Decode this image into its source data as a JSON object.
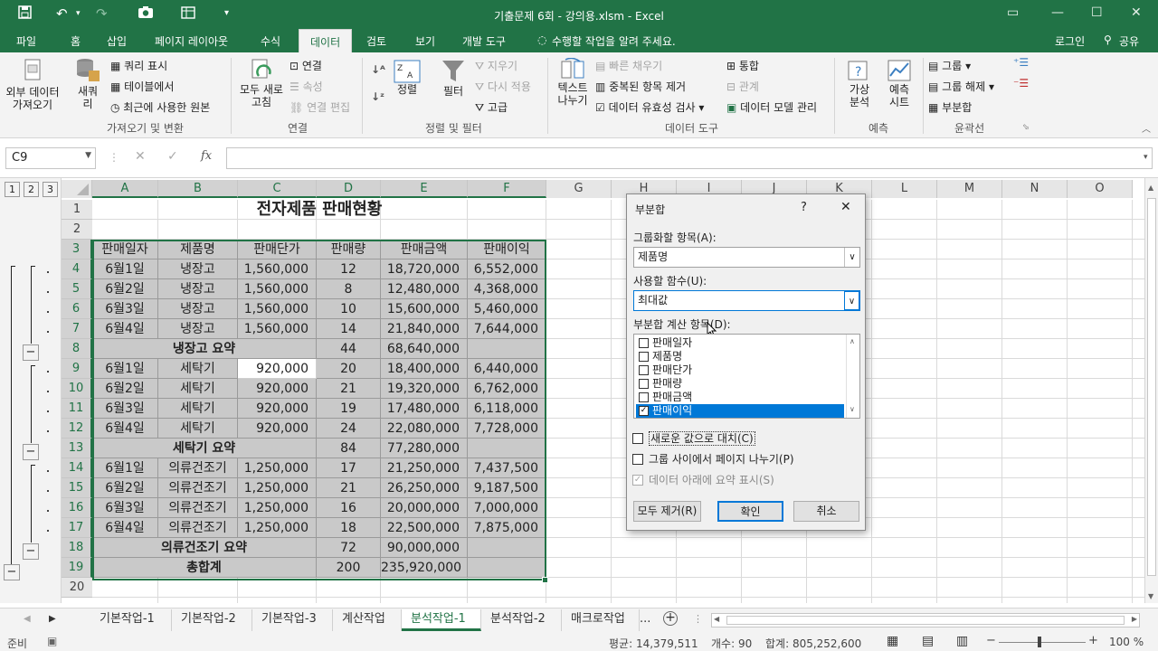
{
  "app": {
    "title": "기출문제 6회 - 강의용.xlsm - Excel",
    "qat_more": "▾"
  },
  "ribbon_tabs": [
    "파일",
    "홈",
    "삽입",
    "페이지 레이아웃",
    "수식",
    "데이터",
    "검토",
    "보기",
    "개발 도구"
  ],
  "tell_me": "수행할 작업을 알려 주세요.",
  "account": {
    "login": "로그인",
    "share": "공유"
  },
  "ribbon": {
    "groups": [
      "가져오기 및 변환",
      "연결",
      "정렬 및 필터",
      "데이터 도구",
      "예측",
      "윤곽선"
    ],
    "get_external": "외부 데이터\n가져오기",
    "new_query": "새쿼\n리",
    "show_query": "쿼리 표시",
    "from_table": "테이블에서",
    "recent_sources": "최근에 사용한 원본",
    "refresh_all": "모두 새로\n고침",
    "connections": "연결",
    "properties": "속성",
    "edit_links": "연결 편집",
    "sort": "정렬",
    "filter": "필터",
    "clear": "지우기",
    "reapply": "다시 적용",
    "advanced": "고급",
    "text_to_columns": "텍스트\n나누기",
    "flash_fill": "빠른 채우기",
    "remove_duplicates": "중복된 항목 제거",
    "data_validation": "데이터 유효성 검사",
    "consolidate": "통합",
    "relationships": "관계",
    "data_model": "데이터 모델 관리",
    "whatif": "가상\n분석",
    "forecast_sheet": "예측\n시트",
    "group": "그룹",
    "ungroup": "그룹 해제",
    "subtotal": "부분합"
  },
  "formula_bar": {
    "name_box": "C9",
    "fx": "fx",
    "value": ""
  },
  "outline_levels": [
    "1",
    "2",
    "3"
  ],
  "columns": [
    "A",
    "B",
    "C",
    "D",
    "E",
    "F",
    "G",
    "H",
    "I",
    "J",
    "K",
    "L",
    "M",
    "N",
    "O"
  ],
  "rows": [
    "1",
    "2",
    "3",
    "4",
    "5",
    "6",
    "7",
    "8",
    "9",
    "10",
    "11",
    "12",
    "13",
    "14",
    "15",
    "16",
    "17",
    "18",
    "19",
    "20"
  ],
  "sheet": {
    "title": "전자제품 판매현황",
    "headers": [
      "판매일자",
      "제품명",
      "판매단가",
      "판매량",
      "판매금액",
      "판매이익"
    ],
    "data": [
      [
        "6월1일",
        "냉장고",
        "1,560,000",
        "12",
        "18,720,000",
        "6,552,000"
      ],
      [
        "6월2일",
        "냉장고",
        "1,560,000",
        "8",
        "12,480,000",
        "4,368,000"
      ],
      [
        "6월3일",
        "냉장고",
        "1,560,000",
        "10",
        "15,600,000",
        "5,460,000"
      ],
      [
        "6월4일",
        "냉장고",
        "1,560,000",
        "14",
        "21,840,000",
        "7,644,000"
      ],
      [
        "",
        "냉장고 요약",
        "",
        "44",
        "68,640,000",
        ""
      ],
      [
        "6월1일",
        "세탁기",
        "920,000",
        "20",
        "18,400,000",
        "6,440,000"
      ],
      [
        "6월2일",
        "세탁기",
        "920,000",
        "21",
        "19,320,000",
        "6,762,000"
      ],
      [
        "6월3일",
        "세탁기",
        "920,000",
        "19",
        "17,480,000",
        "6,118,000"
      ],
      [
        "6월4일",
        "세탁기",
        "920,000",
        "24",
        "22,080,000",
        "7,728,000"
      ],
      [
        "",
        "세탁기 요약",
        "",
        "84",
        "77,280,000",
        ""
      ],
      [
        "6월1일",
        "의류건조기",
        "1,250,000",
        "17",
        "21,250,000",
        "7,437,500"
      ],
      [
        "6월2일",
        "의류건조기",
        "1,250,000",
        "21",
        "26,250,000",
        "9,187,500"
      ],
      [
        "6월3일",
        "의류건조기",
        "1,250,000",
        "16",
        "20,000,000",
        "7,000,000"
      ],
      [
        "6월4일",
        "의류건조기",
        "1,250,000",
        "18",
        "22,500,000",
        "7,875,000"
      ],
      [
        "",
        "의류건조기 요약",
        "",
        "72",
        "90,000,000",
        ""
      ],
      [
        "",
        "총합계",
        "",
        "200",
        "235,920,000",
        ""
      ]
    ]
  },
  "dialog": {
    "title": "부분합",
    "help": "?",
    "close": "✕",
    "group_by_label": "그룹화할 항목(A):",
    "group_by_value": "제품명",
    "function_label": "사용할 함수(U):",
    "function_value": "최대값",
    "add_to_label": "부분합 계산 항목(D):",
    "fields": [
      "판매일자",
      "제품명",
      "판매단가",
      "판매량",
      "판매금액",
      "판매이익"
    ],
    "checked_field": "판매이익",
    "replace_current": "새로운 값으로 대치(C)",
    "page_break": "그룹 사이에서 페이지 나누기(P)",
    "summary_below": "데이터 아래에 요약 표시(S)",
    "remove_all": "모두 제거(R)",
    "ok": "확인",
    "cancel": "취소"
  },
  "sheet_tabs": [
    "기본작업-1",
    "기본작업-2",
    "기본작업-3",
    "계산작업",
    "분석작업-1",
    "분석작업-2",
    "매크로작업"
  ],
  "active_sheet": "분석작업-1",
  "more_tabs": "...",
  "status": {
    "ready": "준비",
    "average": "평균:  14,379,511",
    "count": "개수: 90",
    "sum": "합계:  805,252,600",
    "zoom": "100 %"
  },
  "colors": {
    "accent": "#217346",
    "selection": "#0078d7"
  }
}
